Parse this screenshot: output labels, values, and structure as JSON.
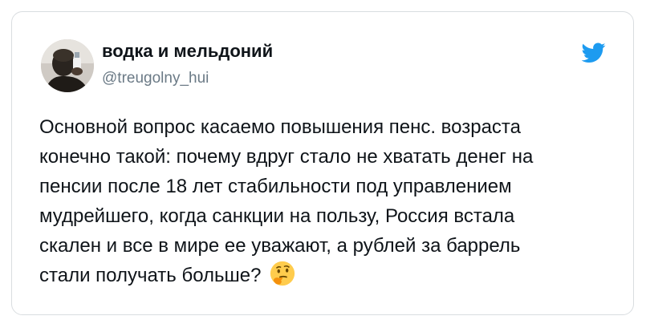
{
  "tweet": {
    "display_name": "водка и мельдоний",
    "handle": "@treugolny_hui",
    "text_lines": [
      "Основной вопрос касаемо повышения пенс. возраста",
      "конечно такой: почему вдруг стало не хватать денег на",
      "пенсии после 18 лет стабильности под управлением",
      "мудрейшего, когда санкции на пользу, Россия встала",
      "скален и все в мире ее уважают, а рублей за баррель",
      "стали получать больше?"
    ],
    "emoji": "thinking-face-icon"
  },
  "colors": {
    "text": "#0f1419",
    "secondary": "#6b7a86",
    "twitter_blue": "#1d9bf0",
    "border": "#d9dde0"
  },
  "icons": {
    "brand": "twitter-bird-icon"
  }
}
